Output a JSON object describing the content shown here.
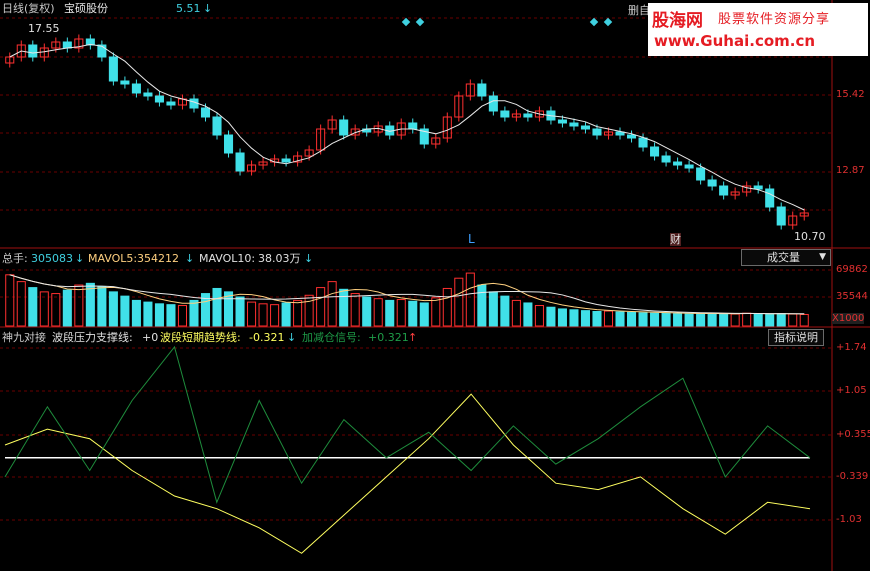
{
  "price_panel": {
    "title": "日线(复权)",
    "stock_name": "宝硕股份",
    "header_value": "5.51",
    "corner_label": "删自",
    "high_label": "17.55",
    "low_label": "10.70",
    "axis_ticks": [
      "15.42",
      "12.87"
    ],
    "markers": {
      "l_marker": "L",
      "cai_marker": "财"
    }
  },
  "volume_panel": {
    "total_label": "总手:",
    "total_value": "305083",
    "mavol5_label": "MAVOL5:",
    "mavol5_value": "354212",
    "mavol10_label": "MAVOL10:",
    "mavol10_value": "38.03万",
    "dropdown_label": "成交量",
    "axis_ticks": [
      "69862",
      "35544"
    ],
    "unit_label": "X1000"
  },
  "indicator_panel": {
    "name": "神九对接",
    "support_label": "波段压力支撑线:",
    "support_value": "+0",
    "trend_label": "波段短期趋势线:",
    "trend_value": "-0.321",
    "signal_label": "加减仓信号:",
    "signal_value": "+0.321",
    "help_button": "指标说明",
    "axis_ticks": [
      "+1.74",
      "+1.05",
      "+0.355",
      "-0.339",
      "-1.03"
    ]
  },
  "watermark": {
    "brand": "股海网",
    "slogan": "股票软件资源分享",
    "url": "www.Guhai.com.cn"
  },
  "colors": {
    "up": "#ff3030",
    "down": "#40e0e8",
    "grid": "#6a0000",
    "yellow": "#ffff60",
    "green": "#1e8c3c",
    "white_line": "#ffffff"
  },
  "chart_data": [
    {
      "type": "candlestick",
      "title": "宝硕股份 日线(复权)",
      "ylim": [
        10.5,
        17.9
      ],
      "yticks": [
        15.42,
        12.87
      ],
      "series": [
        {
          "values": [
            16.6,
            17.0,
            16.6,
            16.9,
            17.1,
            16.9,
            17.2,
            17.0,
            16.6,
            15.8,
            15.7,
            15.4,
            15.3,
            15.1,
            15.0,
            15.2,
            14.9,
            14.6,
            14.0,
            13.4,
            12.8,
            13.0,
            13.1,
            13.2,
            13.1,
            13.3,
            13.5,
            14.2,
            14.5,
            14.0,
            14.2,
            14.1,
            14.3,
            14.0,
            14.4,
            14.2,
            13.7,
            13.9,
            14.6,
            15.3,
            15.7,
            15.3,
            14.8,
            14.6,
            14.7,
            14.6,
            14.8,
            14.5,
            14.4,
            14.3,
            14.2,
            14.0,
            14.1,
            14.0,
            13.9,
            13.6,
            13.3,
            13.1,
            13.0,
            12.9,
            12.5,
            12.3,
            12.0,
            12.1,
            12.3,
            12.2,
            11.6,
            11.0,
            11.3,
            11.4
          ]
        }
      ]
    },
    {
      "type": "bar",
      "title": "成交量",
      "ylim": [
        0,
        75000
      ],
      "yticks": [
        69862,
        35544
      ],
      "series": [
        {
          "name": "总手",
          "values": [
            60000,
            52000,
            45000,
            40000,
            38000,
            42000,
            48000,
            50000,
            46000,
            40000,
            35000,
            30000,
            28000,
            26000,
            25000,
            24000,
            30000,
            38000,
            44000,
            40000,
            34000,
            28000,
            26000,
            25000,
            27000,
            30000,
            36000,
            45000,
            52000,
            43000,
            38000,
            34000,
            32000,
            30000,
            31000,
            29000,
            27000,
            33000,
            44000,
            56000,
            62000,
            48000,
            40000,
            35000,
            30000,
            27000,
            24000,
            22000,
            20000,
            19000,
            18000,
            17000,
            17500,
            16500,
            16000,
            15500,
            15000,
            15500,
            14500,
            14000,
            14500,
            15000,
            14500,
            14000,
            15000,
            14500,
            14000,
            14500,
            14000,
            13500
          ]
        }
      ]
    },
    {
      "type": "line",
      "title": "神九对接",
      "ylim": [
        -1.7,
        1.85
      ],
      "yticks": [
        1.74,
        1.05,
        0.355,
        -0.339,
        -1.03
      ],
      "series": [
        {
          "name": "波段压力支撑线",
          "values": [
            0.0,
            0.0,
            0.0,
            0.0,
            0.0,
            0.0,
            0.0,
            0.0,
            0.0,
            0.0,
            0.0,
            0.0,
            0.0,
            0.0,
            0.0,
            0.0,
            0.0,
            0.0,
            0.0,
            0.0
          ]
        },
        {
          "name": "波段短期趋势线",
          "values": [
            0.2,
            0.45,
            0.3,
            -0.2,
            -0.6,
            -0.8,
            -1.1,
            -1.5,
            -0.9,
            -0.3,
            0.3,
            1.0,
            0.2,
            -0.4,
            -0.5,
            -0.3,
            -0.8,
            -1.2,
            -0.7,
            -0.8
          ]
        },
        {
          "name": "加减仓信号",
          "values": [
            -0.3,
            0.8,
            -0.2,
            0.9,
            1.74,
            -0.7,
            0.9,
            -0.4,
            0.6,
            0.0,
            0.4,
            -0.2,
            0.5,
            -0.1,
            0.3,
            0.8,
            1.25,
            -0.3,
            0.5,
            0.0
          ]
        }
      ]
    }
  ]
}
